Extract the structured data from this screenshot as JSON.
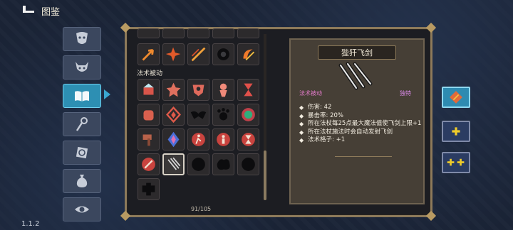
{
  "header": {
    "title": "图鉴",
    "back_icon": "back-arrow-icon"
  },
  "version": "1.1.2",
  "category_tabs": [
    {
      "icon": "mask-icon",
      "active": false
    },
    {
      "icon": "demon-head-icon",
      "active": false
    },
    {
      "icon": "book-icon",
      "active": true
    },
    {
      "icon": "staff-icon",
      "active": false
    },
    {
      "icon": "rune-icon",
      "active": false
    },
    {
      "icon": "pouch-icon",
      "active": false
    },
    {
      "icon": "eye-icon",
      "active": false
    }
  ],
  "grid": {
    "section_label": "法术被动",
    "counter": "91/105"
  },
  "detail": {
    "name": "狴犴飞剑",
    "type": "法术被动",
    "rarity": "独特",
    "stats": [
      "伤害: 42",
      "暴击率: 20%",
      "所在法杖每25点最大魔法值使飞剑上限+1",
      "所在法杖施法时会自动发射飞剑",
      "法术格子: +1"
    ]
  },
  "side_buttons": [
    {
      "icon": "slot-single-active-icon",
      "active": true
    },
    {
      "icon": "plus-icon",
      "active": false
    },
    {
      "icon": "double-plus-icon",
      "active": false
    }
  ],
  "colors": {
    "accent": "#2d8fb3",
    "frame": "#8d7a5a",
    "rarity": "#d98ae8"
  }
}
